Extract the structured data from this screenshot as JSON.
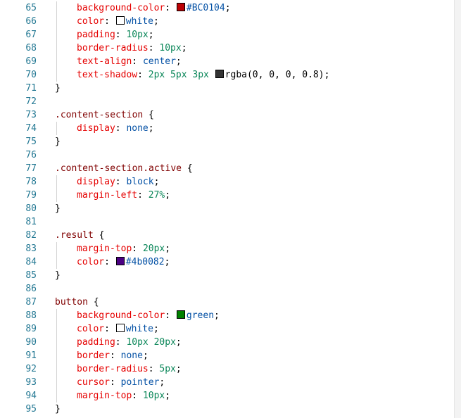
{
  "editor": {
    "lines": [
      {
        "n": "65",
        "kind": "decl",
        "prop": "background-color",
        "swatch": "#BC0104",
        "value": "#BC0104",
        "vclass": "val"
      },
      {
        "n": "66",
        "kind": "decl",
        "prop": "color",
        "swatch": "#ffffff",
        "value": "white",
        "vclass": "val"
      },
      {
        "n": "67",
        "kind": "decl",
        "prop": "padding",
        "value": "10px",
        "vclass": "num"
      },
      {
        "n": "68",
        "kind": "decl",
        "prop": "border-radius",
        "value": "10px",
        "vclass": "num"
      },
      {
        "n": "69",
        "kind": "decl",
        "prop": "text-align",
        "value": "center",
        "vclass": "val"
      },
      {
        "n": "70",
        "kind": "shadow",
        "prop": "text-shadow",
        "pre": "2px 5px 3px",
        "swatch": "#333333",
        "value": "rgba(0, 0, 0, 0.8)"
      },
      {
        "n": "71",
        "kind": "close",
        "text": "}"
      },
      {
        "n": "72",
        "kind": "blank"
      },
      {
        "n": "73",
        "kind": "open",
        "selector": ".content-section"
      },
      {
        "n": "74",
        "kind": "decl",
        "prop": "display",
        "value": "none",
        "vclass": "val"
      },
      {
        "n": "75",
        "kind": "close",
        "text": "}"
      },
      {
        "n": "76",
        "kind": "blank"
      },
      {
        "n": "77",
        "kind": "open",
        "selector": ".content-section.active"
      },
      {
        "n": "78",
        "kind": "decl",
        "prop": "display",
        "value": "block",
        "vclass": "val"
      },
      {
        "n": "79",
        "kind": "decl",
        "prop": "margin-left",
        "value": "27%",
        "vclass": "num"
      },
      {
        "n": "80",
        "kind": "close",
        "text": "}"
      },
      {
        "n": "81",
        "kind": "blank"
      },
      {
        "n": "82",
        "kind": "open",
        "selector": ".result"
      },
      {
        "n": "83",
        "kind": "decl",
        "prop": "margin-top",
        "value": "20px",
        "vclass": "num"
      },
      {
        "n": "84",
        "kind": "decl",
        "prop": "color",
        "swatch": "#4b0082",
        "value": "#4b0082",
        "vclass": "val"
      },
      {
        "n": "85",
        "kind": "close",
        "text": "}"
      },
      {
        "n": "86",
        "kind": "blank"
      },
      {
        "n": "87",
        "kind": "open",
        "selector": "button"
      },
      {
        "n": "88",
        "kind": "decl",
        "prop": "background-color",
        "swatch": "#008000",
        "value": "green",
        "vclass": "val"
      },
      {
        "n": "89",
        "kind": "decl",
        "prop": "color",
        "swatch": "#ffffff",
        "value": "white",
        "vclass": "val"
      },
      {
        "n": "90",
        "kind": "decl",
        "prop": "padding",
        "value": "10px 20px",
        "vclass": "num"
      },
      {
        "n": "91",
        "kind": "decl",
        "prop": "border",
        "value": "none",
        "vclass": "val"
      },
      {
        "n": "92",
        "kind": "decl",
        "prop": "border-radius",
        "value": "5px",
        "vclass": "num"
      },
      {
        "n": "93",
        "kind": "decl",
        "prop": "cursor",
        "value": "pointer",
        "vclass": "val"
      },
      {
        "n": "94",
        "kind": "decl",
        "prop": "margin-top",
        "value": "10px",
        "vclass": "num"
      },
      {
        "n": "95",
        "kind": "close",
        "text": "}"
      }
    ]
  }
}
